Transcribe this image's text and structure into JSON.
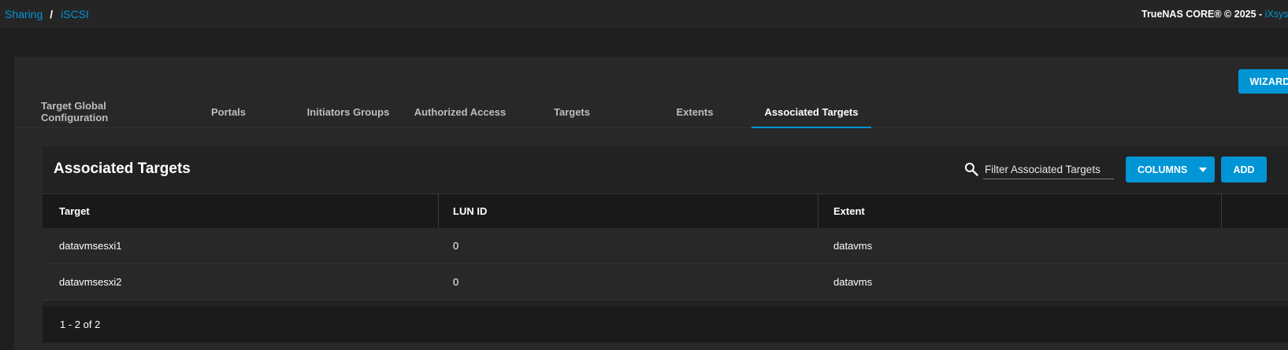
{
  "breadcrumb": {
    "items": [
      "Sharing",
      "iSCSI"
    ],
    "separator": "/"
  },
  "copyright": {
    "text": "TrueNAS CORE® © 2025 - ",
    "company": "iXsystems, Inc."
  },
  "wizard_label": "WIZARD",
  "tabs": [
    {
      "label": "Target Global Configuration",
      "active": false
    },
    {
      "label": "Portals",
      "active": false
    },
    {
      "label": "Initiators Groups",
      "active": false
    },
    {
      "label": "Authorized Access",
      "active": false
    },
    {
      "label": "Targets",
      "active": false
    },
    {
      "label": "Extents",
      "active": false
    },
    {
      "label": "Associated Targets",
      "active": true
    }
  ],
  "table": {
    "title": "Associated Targets",
    "filter_placeholder": "Filter Associated Targets",
    "columns_label": "COLUMNS",
    "add_label": "ADD",
    "headers": [
      "Target",
      "LUN ID",
      "Extent"
    ],
    "rows": [
      {
        "target": "datavmsesxi1",
        "lun_id": "0",
        "extent": "datavms"
      },
      {
        "target": "datavmsesxi2",
        "lun_id": "0",
        "extent": "datavms"
      }
    ],
    "pagination": "1 - 2 of 2"
  },
  "colors": {
    "accent": "#0095d5",
    "background": "#1e1e1e",
    "card": "#282828"
  },
  "icons": {
    "search": "search-icon",
    "dropdown": "caret-down-icon",
    "row_menu": "more-vert-icon"
  }
}
